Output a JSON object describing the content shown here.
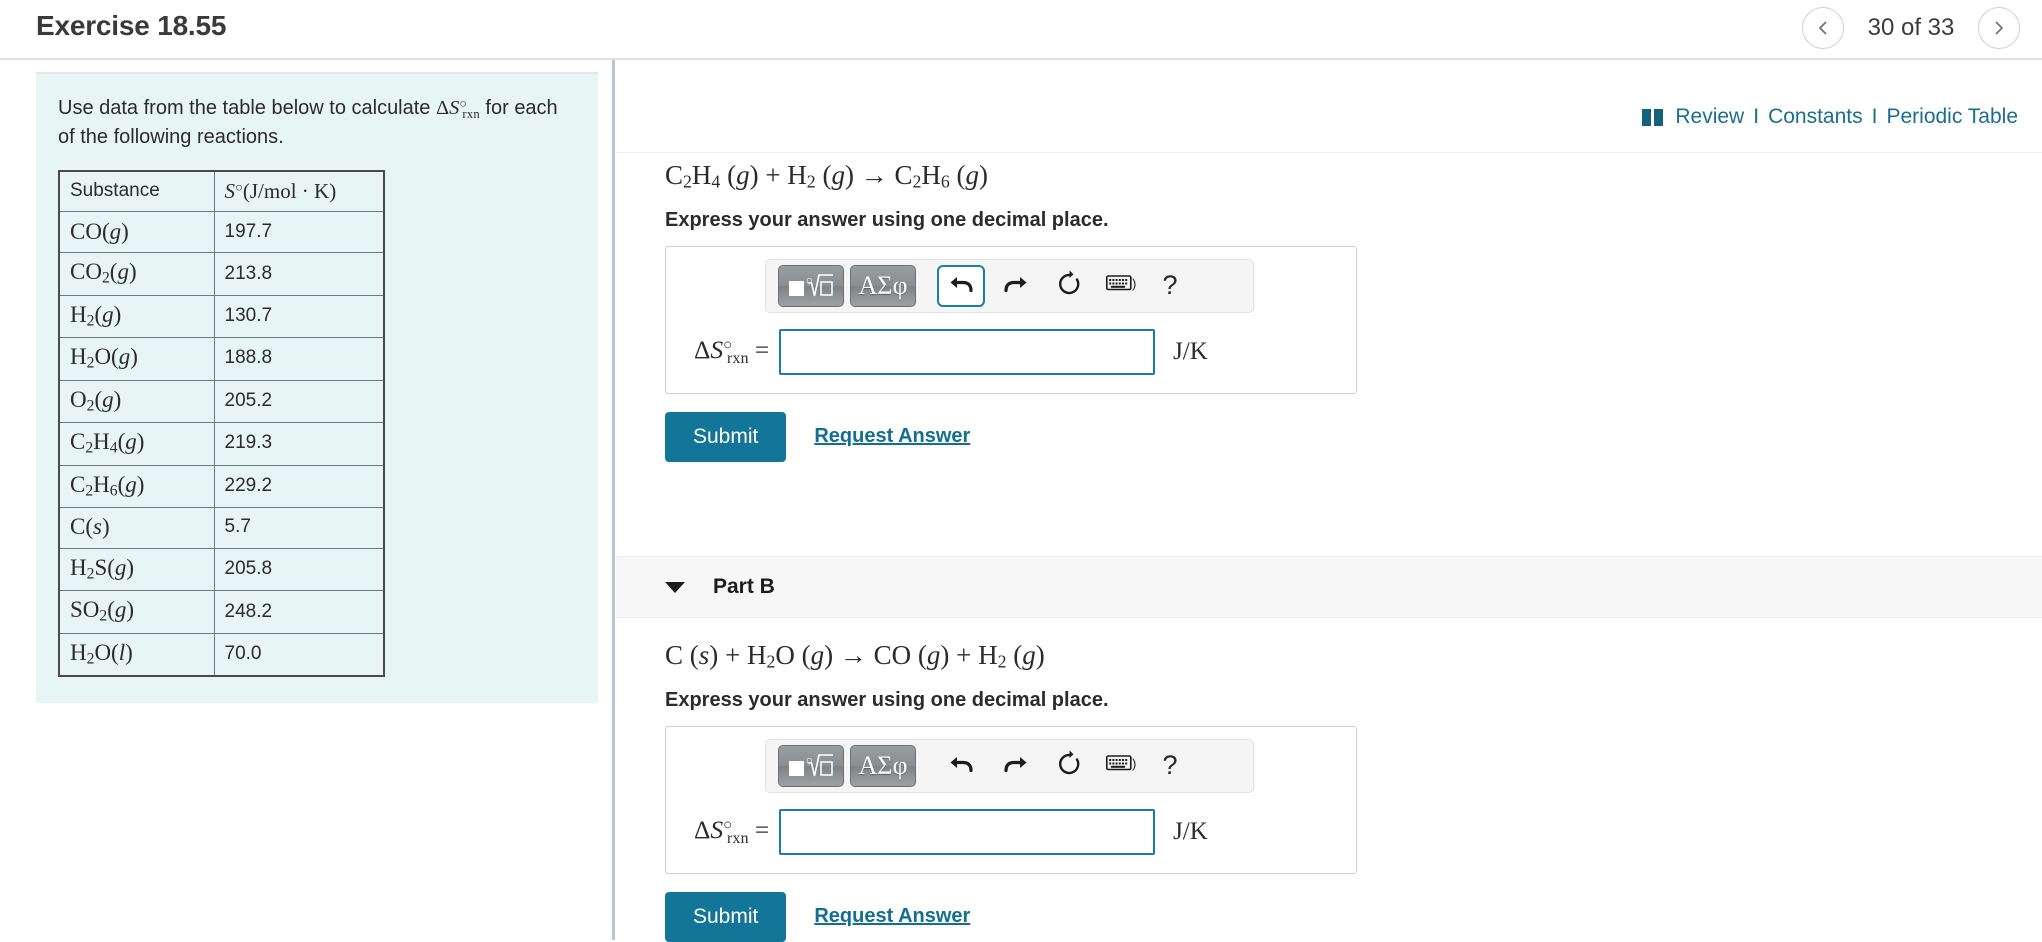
{
  "header": {
    "title": "Exercise 18.55",
    "pager_label": "30 of 33",
    "prev_icon": "chevron-left-icon",
    "next_icon": "chevron-right-icon"
  },
  "toplinks": {
    "book_icon": "book-icon",
    "review": "Review",
    "separator": "I",
    "constants": "Constants",
    "periodic_table": "Periodic Table"
  },
  "left_panel": {
    "statement_prefix": "Use data from the table below to calculate ",
    "statement_symbol": "ΔS°rxn",
    "statement_suffix": " for each of the following reactions.",
    "table": {
      "headers": [
        "Substance",
        "S°(J/mol · K)"
      ],
      "rows": [
        {
          "substance": "CO(g)",
          "value": "197.7"
        },
        {
          "substance": "CO2(g)",
          "value": "213.8"
        },
        {
          "substance": "H2(g)",
          "value": "130.7"
        },
        {
          "substance": "H2O(g)",
          "value": "188.8"
        },
        {
          "substance": "O2(g)",
          "value": "205.2"
        },
        {
          "substance": "C2H4(g)",
          "value": "219.3"
        },
        {
          "substance": "C2H6(g)",
          "value": "229.2"
        },
        {
          "substance": "C(s)",
          "value": "5.7"
        },
        {
          "substance": "H2S(g)",
          "value": "205.8"
        },
        {
          "substance": "SO2(g)",
          "value": "248.2"
        },
        {
          "substance": "H2O(l)",
          "value": "70.0"
        }
      ]
    }
  },
  "parts": [
    {
      "id": "part-a",
      "equation": "C2H4 (g) + H2 (g) → C2H6 (g)",
      "instruction": "Express your answer using one decimal place.",
      "answer_label": "ΔS°rxn =",
      "answer_value": "",
      "answer_unit": "J/K",
      "submit_label": "Submit",
      "request_label": "Request Answer",
      "toolbar": {
        "template_label": "▢√▢",
        "greek_label": "ΑΣφ",
        "undo_icon": "undo-arrow-icon",
        "redo_icon": "redo-arrow-icon",
        "reset_icon": "reset-circular-arrow-icon",
        "keyboard_icon": "keyboard-icon",
        "help_label": "?"
      }
    },
    {
      "id": "part-b",
      "header_label": "Part B",
      "caret_icon": "caret-down-icon",
      "equation": "C (s) + H2O (g) → CO (g) + H2 (g)",
      "instruction": "Express your answer using one decimal place.",
      "answer_label": "ΔS°rxn =",
      "answer_value": "",
      "answer_unit": "J/K",
      "submit_label": "Submit",
      "request_label": "Request Answer",
      "toolbar": {
        "template_label": "▢√▢",
        "greek_label": "ΑΣφ",
        "undo_icon": "undo-arrow-icon",
        "redo_icon": "redo-arrow-icon",
        "reset_icon": "reset-circular-arrow-icon",
        "keyboard_icon": "keyboard-icon",
        "help_label": "?"
      }
    }
  ],
  "colors": {
    "accent_teal": "#137598",
    "link_teal": "#1a6e8e",
    "panel_bg": "#e7f6f5",
    "focus_border": "#1a7fa3"
  }
}
